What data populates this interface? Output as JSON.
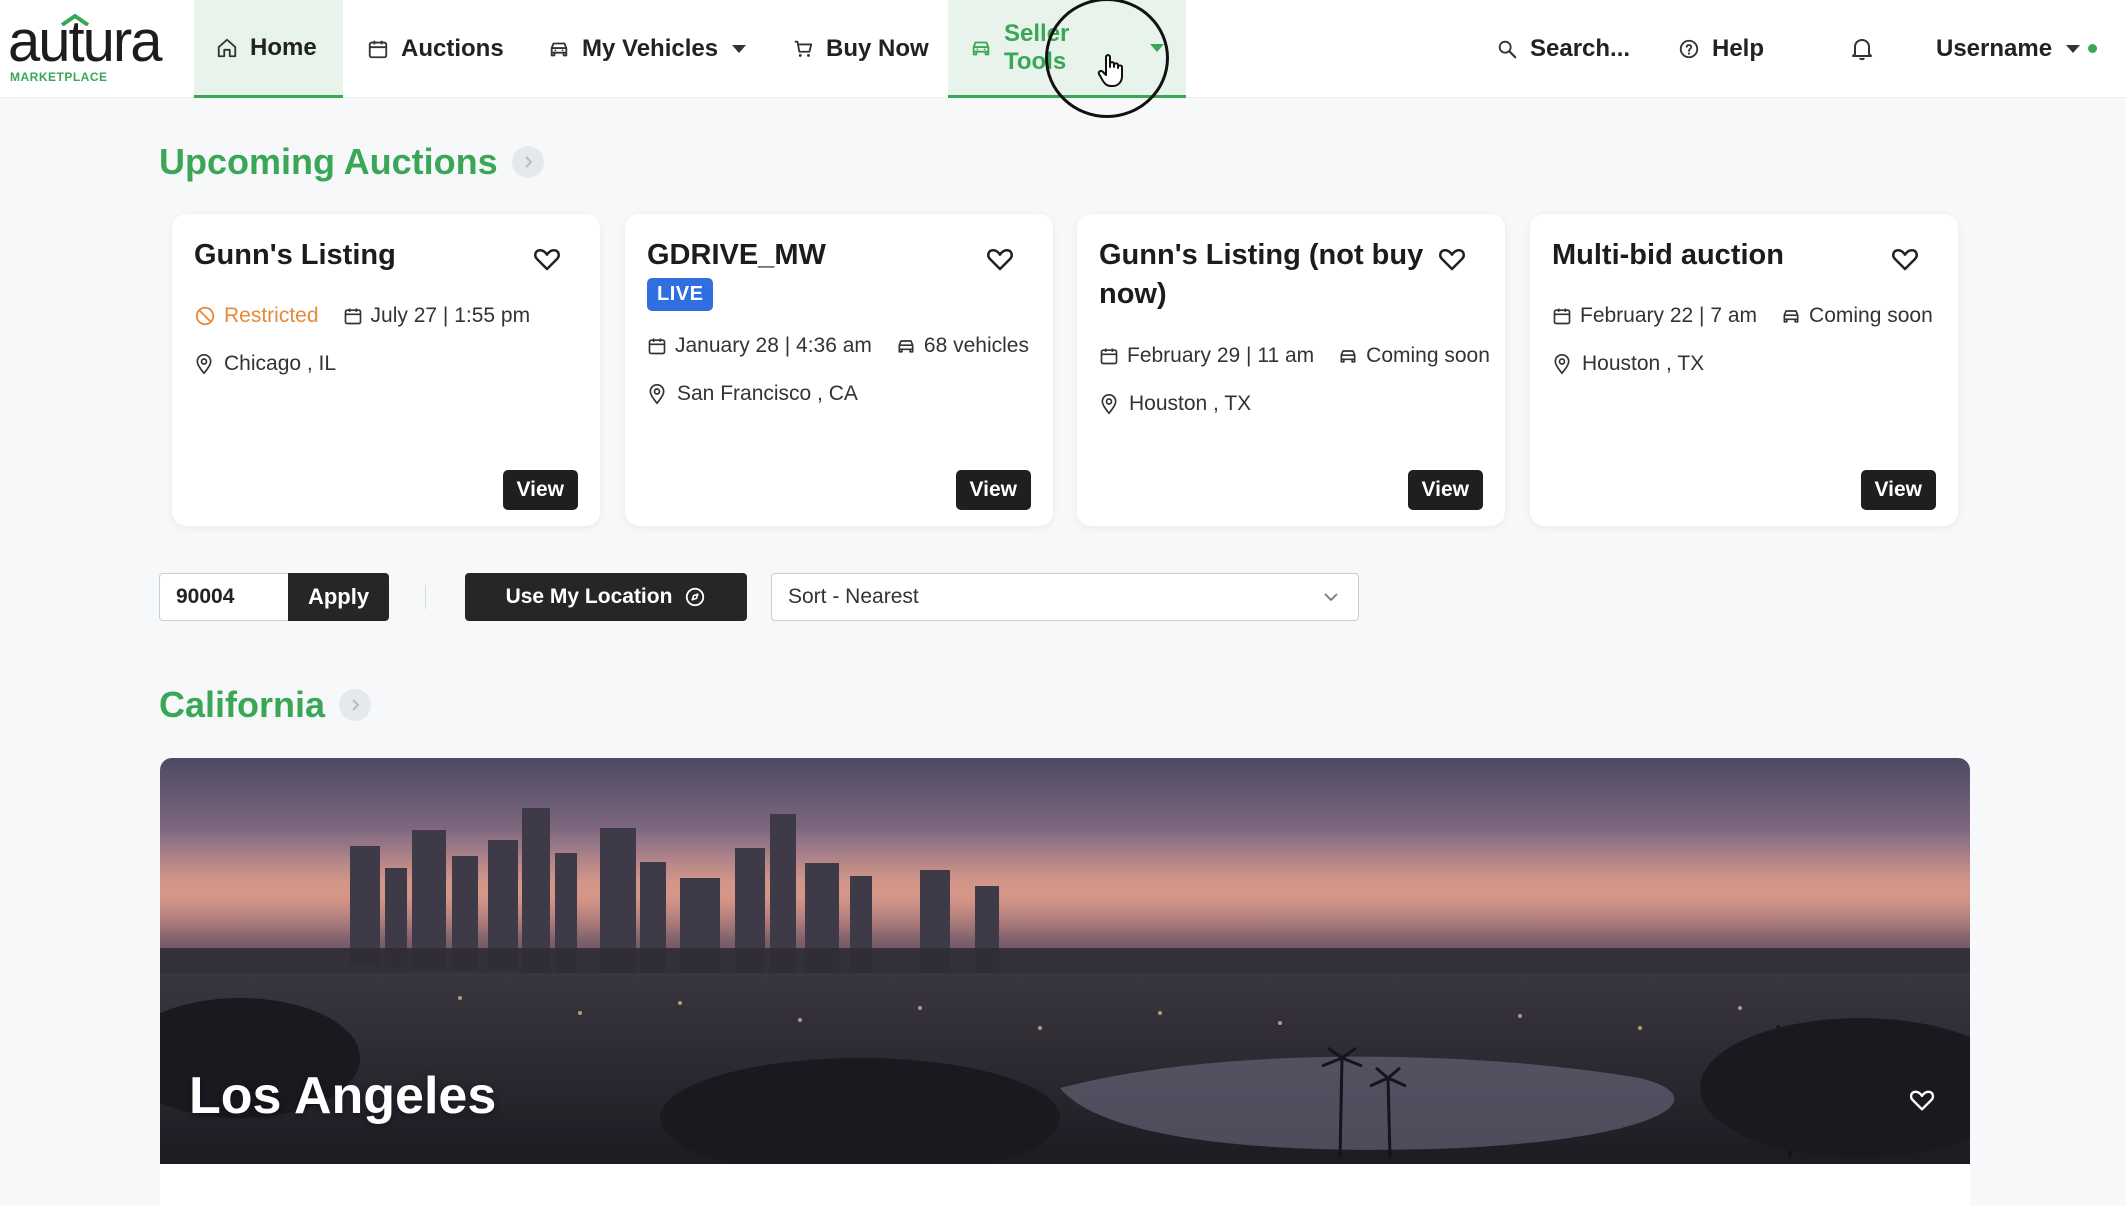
{
  "brand": {
    "name": "autura",
    "sub": "MARKETPLACE"
  },
  "nav": {
    "home": "Home",
    "auctions": "Auctions",
    "my_vehicles": "My Vehicles",
    "buy_now": "Buy Now",
    "seller_tools": "Seller Tools",
    "search": "Search...",
    "help": "Help",
    "username": "Username"
  },
  "upcoming": {
    "title": "Upcoming Auctions",
    "cards": [
      {
        "title": "Gunn's Listing",
        "status": "Restricted",
        "date": "July 27 | 1:55 pm",
        "location": "Chicago , IL",
        "view": "View"
      },
      {
        "title": "GDRIVE_MW",
        "badge": "LIVE",
        "date": "January 28 | 4:36 am",
        "vehicles": "68 vehicles",
        "location": "San Francisco , CA",
        "view": "View"
      },
      {
        "title": "Gunn's Listing (not buy now)",
        "date": "February 29 | 11 am",
        "vehicles": "Coming soon",
        "location": "Houston , TX",
        "view": "View"
      },
      {
        "title": "Multi-bid auction",
        "date": "February 22 | 7 am",
        "vehicles": "Coming soon",
        "location": "Houston , TX",
        "view": "View"
      }
    ]
  },
  "filters": {
    "zip": "90004",
    "apply": "Apply",
    "use_location": "Use My Location",
    "sort": "Sort - Nearest"
  },
  "region": {
    "title": "California",
    "city": "Los Angeles"
  },
  "colors": {
    "accent": "#3aa757",
    "restricted": "#e58a3a",
    "live": "#2f6fe0",
    "dark": "#262626"
  }
}
